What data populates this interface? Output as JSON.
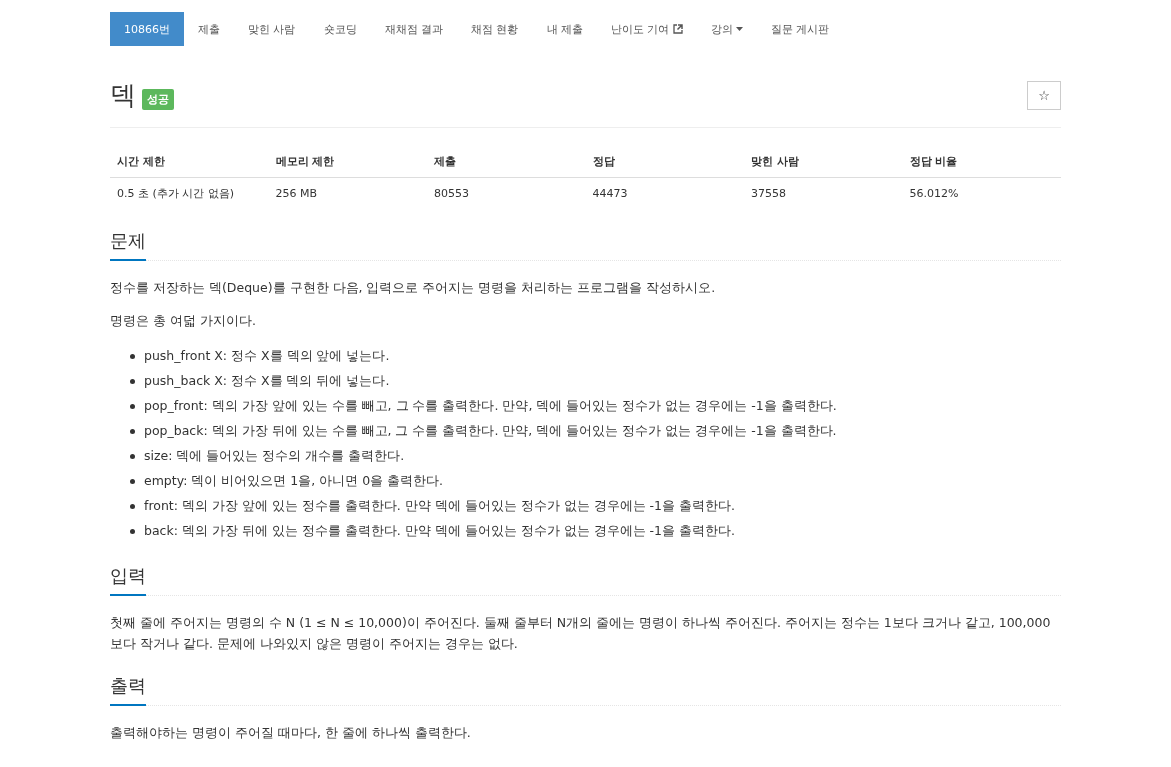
{
  "nav": [
    {
      "label": "10866번",
      "selected": true,
      "kind": "plain"
    },
    {
      "label": "제출",
      "selected": false,
      "kind": "plain"
    },
    {
      "label": "맞힌 사람",
      "selected": false,
      "kind": "plain"
    },
    {
      "label": "숏코딩",
      "selected": false,
      "kind": "plain"
    },
    {
      "label": "재채점 결과",
      "selected": false,
      "kind": "plain"
    },
    {
      "label": "채점 현황",
      "selected": false,
      "kind": "plain"
    },
    {
      "label": "내 제출",
      "selected": false,
      "kind": "plain"
    },
    {
      "label": "난이도 기여",
      "selected": false,
      "kind": "external"
    },
    {
      "label": "강의",
      "selected": false,
      "kind": "dropdown"
    },
    {
      "label": "질문 게시판",
      "selected": false,
      "kind": "plain"
    }
  ],
  "title": "덱",
  "badge": "성공",
  "star_button": "☆",
  "table": {
    "columns": [
      "시간 제한",
      "메모리 제한",
      "제출",
      "정답",
      "맞힌 사람",
      "정답 비율"
    ],
    "rows": [
      [
        "0.5 초 (추가 시간 없음)",
        "256 MB",
        "80553",
        "44473",
        "37558",
        "56.012%"
      ]
    ]
  },
  "sections": [
    {
      "heading": "문제",
      "paragraphs": [
        "정수를 저장하는 덱(Deque)를 구현한 다음, 입력으로 주어지는 명령을 처리하는 프로그램을 작성하시오.",
        "명령은 총 여덟 가지이다."
      ],
      "list": [
        "push_front X: 정수 X를 덱의 앞에 넣는다.",
        "push_back X: 정수 X를 덱의 뒤에 넣는다.",
        "pop_front: 덱의 가장 앞에 있는 수를 빼고, 그 수를 출력한다. 만약, 덱에 들어있는 정수가 없는 경우에는 -1을 출력한다.",
        "pop_back: 덱의 가장 뒤에 있는 수를 빼고, 그 수를 출력한다. 만약, 덱에 들어있는 정수가 없는 경우에는 -1을 출력한다.",
        "size: 덱에 들어있는 정수의 개수를 출력한다.",
        "empty: 덱이 비어있으면 1을, 아니면 0을 출력한다.",
        "front: 덱의 가장 앞에 있는 정수를 출력한다. 만약 덱에 들어있는 정수가 없는 경우에는 -1을 출력한다.",
        "back: 덱의 가장 뒤에 있는 정수를 출력한다. 만약 덱에 들어있는 정수가 없는 경우에는 -1을 출력한다."
      ]
    },
    {
      "heading": "입력",
      "paragraphs": [
        "첫째 줄에 주어지는 명령의 수 N (1 ≤ N ≤ 10,000)이 주어진다. 둘째 줄부터 N개의 줄에는 명령이 하나씩 주어진다. 주어지는 정수는 1보다 크거나 같고, 100,000보다 작거나 같다. 문제에 나와있지 않은 명령이 주어지는 경우는 없다."
      ]
    },
    {
      "heading": "출력",
      "paragraphs": [
        "출력해야하는 명령이 주어질 때마다, 한 줄에 하나씩 출력한다."
      ]
    }
  ]
}
